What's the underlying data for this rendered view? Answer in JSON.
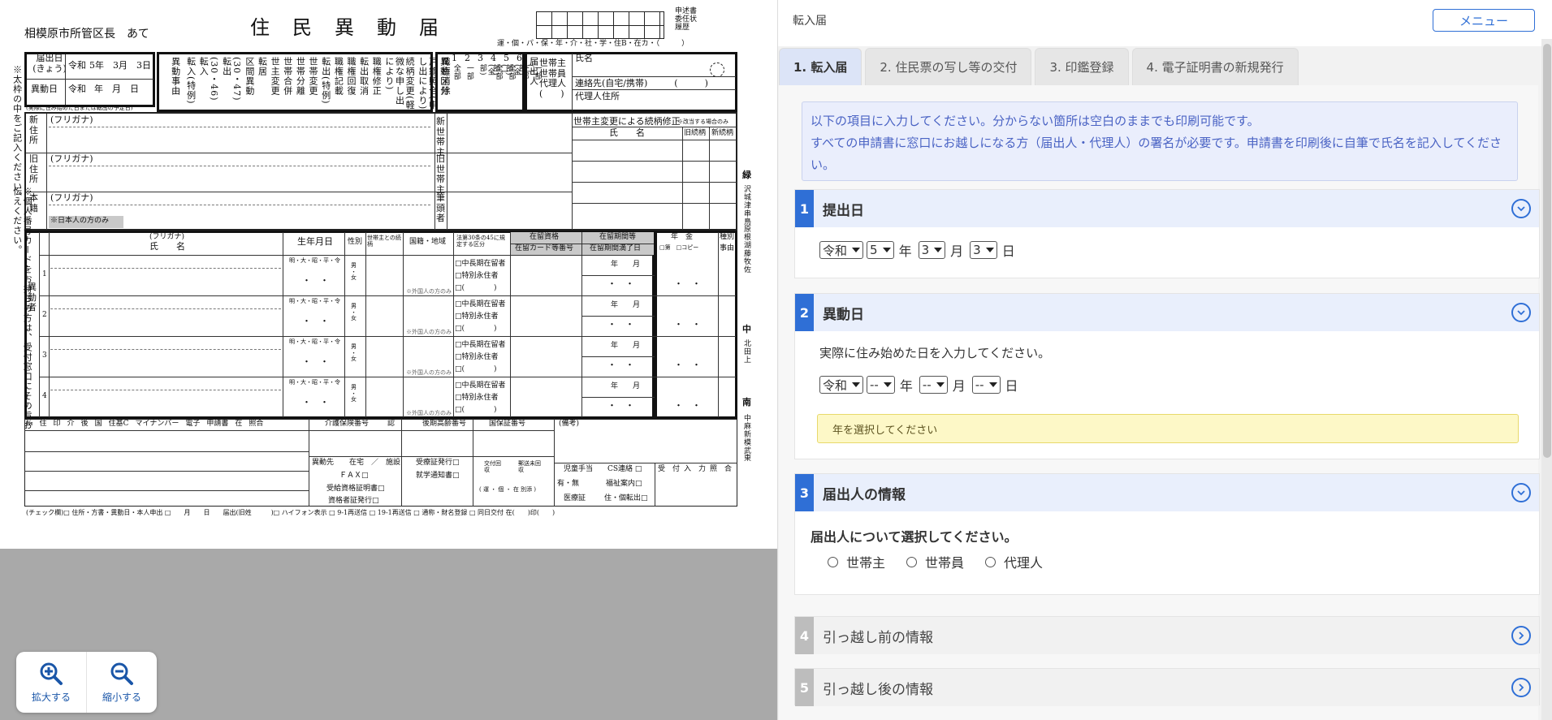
{
  "form": {
    "title": "住　民　異　動　届",
    "recipient": "相模原市所管区長　あて",
    "stamp_labels": [
      "申述書",
      "委任状",
      "履歴"
    ],
    "line_codes": "運・個・パ・保・年・介・社・学・住B・在カ・（　　　）",
    "submit_date_label": "届出日\n(きょう)",
    "move_date_label": "異動日",
    "era_a": "令和",
    "era_a_value": "5年　3月　3日",
    "era_b": "令和",
    "era_b_value": "年　月　日",
    "date_note": "(実際に住み始めた日または転出の予定日)",
    "reasons": [
      "転入(特例)",
      "(30・46)転入",
      "(30・47)転出",
      "区間異動",
      "転居",
      "世主変更",
      "世帯合併",
      "世帯分離",
      "世帯変更",
      "転出(特例)",
      "職権記載",
      "職権回復",
      "転出取消",
      "職権修正",
      "続柄変更(軽微な申し出により)",
      "戸籍照合(申し出により)",
      "職権消除"
    ],
    "reason_header": "異動事由",
    "category_header": "異動区分",
    "category_nums": [
      "1",
      "2",
      "3",
      "4",
      "5",
      "6"
    ],
    "category_labels": [
      "全部",
      "一部",
      "全部(全部)",
      "全部(一部)",
      "一部(全部)",
      "一部(一部)"
    ],
    "declarant_header": "届出人",
    "declarant_types": "世帯主\n世帯員\n代理人\n(　　)",
    "name_label": "氏名",
    "contact_label": "連絡先(自宅/携帯)　　　(　　　)",
    "agent_label": "代理人住所",
    "household_change_label": "世帯主変更による続柄修正",
    "household_change_note": "※改当する場合のみ",
    "sub_name": "氏　　名",
    "old_rel": "旧続柄",
    "new_rel": "新続柄",
    "new_addr": "新住所",
    "old_addr": "旧住所",
    "honseki": "本籍",
    "furigana": "(フリガナ)",
    "new_head": "新世帯主",
    "old_head": "旧世帯主",
    "head_name": "筆頭者",
    "japanese_only": "※日本人の方のみ",
    "left_note": "※太枠の中をご記入ください。",
    "left_note2": "※個人番号カードをお持ちの方は、受付窓口にその旨お伝えください。",
    "person_section": "異動者",
    "col_furigana": "(フリガナ)",
    "col_name": "氏　　名",
    "col_birth": "生年月日",
    "col_sex": "性別",
    "col_relation": "世帯主との続柄",
    "col_nationality": "国籍・地域",
    "col_law": "法第30条の45に規定する区分",
    "col_status": "在留資格",
    "col_card": "在留カード等番号",
    "col_period": "在留期間等",
    "col_expiry": "在留期間満了日",
    "col_pension": "年　金",
    "col_pension_sub": "□第　□コピー",
    "col_kind": "種別",
    "col_kind_sub": "事由",
    "row_nums": [
      "1",
      "2",
      "3",
      "4"
    ],
    "birth_eras": "明・大・昭・平・令",
    "sex_options": "男\n・\n女",
    "foreign_only": "※外国人の方のみ",
    "law_options": "□中長期在留者\n□特別永住者\n□(　　　　)",
    "ym": "年　　月",
    "dots": "・　・",
    "bottom_headers": [
      "№",
      "住",
      "印",
      "介",
      "後",
      "国",
      "住基C",
      "マイナンバー",
      "電子",
      "申請書",
      "在",
      "照合"
    ],
    "insurance_no": "介護保険番号",
    "cert": "認",
    "late_elder": "後期高齢番号",
    "nhi_no": "国保証番号",
    "note_label": "(備考)",
    "dest": "異動先",
    "home_facility": "在宅　／　施設",
    "fax": "ＦＡＸ□",
    "receive_cert": "受給資格証明書□",
    "qualified_cert": "資格者証発行□",
    "medical_issue": "受療証発行□",
    "school_notice": "就学通知書□",
    "delivery": "交付回収",
    "mail": "郵送未回収",
    "choice": "( 運 ・ 個 ・ 在 別添 )",
    "child_allow": "児童手当",
    "cs_contact": "CS連絡 □",
    "care_info": "有・無",
    "welfare": "福祉案内□",
    "medical": "医療証",
    "transfer": "住・個転出□",
    "accept": "受　付",
    "input": "入　力",
    "verify": "照　合",
    "check_row": "(チェック欄)□ 住所・方書・異動日・本人申出 □　　月　　日　　届出(旧姓　　　)□ ハイフォン表示 □ 9-1再送信 □ 19-1再送信 □ 通称・財名登録 □ 同日交付 在(　　)印(　　)",
    "side_labels": [
      "緑",
      "沢城津串鳥原根湖藤牧佐",
      "中",
      "北田上",
      "南",
      "中麻新模武東"
    ]
  },
  "zoom": {
    "zoom_in_label": "拡大する",
    "zoom_out_label": "縮小する",
    "zoom_in_icon": "zoom-in-icon",
    "zoom_out_icon": "zoom-out-icon"
  },
  "header": {
    "title": "転入届",
    "menu_label": "メニュー"
  },
  "tabs": [
    {
      "label": "1. 転入届",
      "active": true
    },
    {
      "label": "2. 住民票の写し等の交付",
      "active": false
    },
    {
      "label": "3. 印鑑登録",
      "active": false
    },
    {
      "label": "4. 電子証明書の新規発行",
      "active": false
    }
  ],
  "notice": {
    "line1": "以下の項目に入力してください。分からない箇所は空白のままでも印刷可能です。",
    "line2": "すべての申請書に窓口にお越しになる方（届出人・代理人）の署名が必要です。申請書を印刷後に自筆で氏名を記入してください。"
  },
  "sections": {
    "s1": {
      "num": "1",
      "title": "提出日",
      "era": "令和",
      "year": "5",
      "year_unit": "年",
      "month": "3",
      "month_unit": "月",
      "day": "3",
      "day_unit": "日"
    },
    "s2": {
      "num": "2",
      "title": "異動日",
      "hint": "実際に住み始めた日を入力してください。",
      "era": "令和",
      "year": "--",
      "year_unit": "年",
      "month": "--",
      "month_unit": "月",
      "day": "--",
      "day_unit": "日",
      "warning": "年を選択してください"
    },
    "s3": {
      "num": "3",
      "title": "届出人の情報",
      "question": "届出人について選択してください。",
      "options": [
        "世帯主",
        "世帯員",
        "代理人"
      ]
    },
    "s4": {
      "num": "4",
      "title": "引っ越し前の情報"
    },
    "s5": {
      "num": "5",
      "title": "引っ越し後の情報"
    }
  },
  "colors": {
    "accent": "#2f6fd6",
    "notice_bg": "#eaeefc",
    "warning_bg": "#fdf8c7"
  }
}
